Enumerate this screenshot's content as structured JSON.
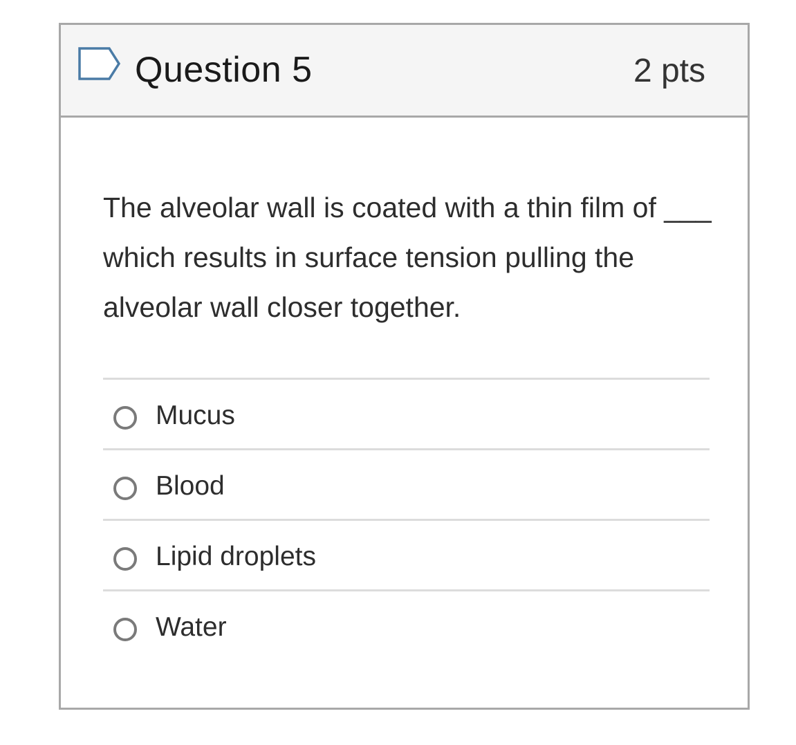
{
  "question": {
    "flag_icon": "flag-icon",
    "title": "Question 5",
    "points": "2 pts",
    "text": "The alveolar wall is coated with a thin film of ___ which results in surface tension pulling the alveolar wall closer together."
  },
  "answers": [
    {
      "label": "Mucus",
      "selected": false
    },
    {
      "label": "Blood",
      "selected": false
    },
    {
      "label": "Lipid droplets",
      "selected": false
    },
    {
      "label": "Water",
      "selected": false
    }
  ],
  "colors": {
    "header_bg": "#f5f5f5",
    "border": "#a8a8a8",
    "flag_stroke": "#4a7ba6",
    "divider": "#dcdcdc",
    "radio_border": "#7a7a7a"
  }
}
